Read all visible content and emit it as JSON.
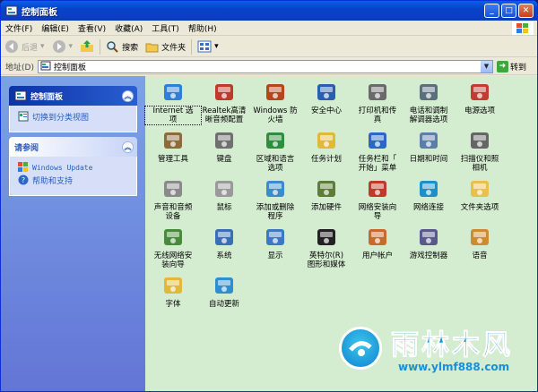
{
  "window": {
    "title": "控制面板",
    "buttons": {
      "minimize": "_",
      "maximize": "□",
      "close": "✕"
    }
  },
  "menu": [
    "文件(F)",
    "编辑(E)",
    "查看(V)",
    "收藏(A)",
    "工具(T)",
    "帮助(H)"
  ],
  "toolbar": {
    "back": "后退",
    "forward": "",
    "up": "",
    "search": "搜索",
    "folders": "文件夹",
    "views": ""
  },
  "address": {
    "label": "地址(D)",
    "value": "控制面板",
    "go": "转到"
  },
  "sidebar": {
    "panel1": {
      "title": "控制面板",
      "link": "切换到分类视图"
    },
    "panel2": {
      "title": "请参阅",
      "links": [
        "Windows Update",
        "帮助和支持"
      ]
    }
  },
  "items": [
    {
      "label": "Internet 选\n项",
      "icon": "internet-options-icon",
      "color": "#2f7ed8"
    },
    {
      "label": "Realtek高清\n晰音频配置",
      "icon": "realtek-audio-icon",
      "color": "#c0392b"
    },
    {
      "label": "Windows 防\n火墙",
      "icon": "firewall-icon",
      "color": "#b5451b"
    },
    {
      "label": "安全中心",
      "icon": "security-center-icon",
      "color": "#2a5fb0"
    },
    {
      "label": "打印机和传\n真",
      "icon": "printer-icon",
      "color": "#6a6a6a"
    },
    {
      "label": "电话和调制\n解调器选项",
      "icon": "phone-modem-icon",
      "color": "#5b6f7d"
    },
    {
      "label": "电源选项",
      "icon": "power-options-icon",
      "color": "#c43b2f"
    },
    {
      "label": "管理工具",
      "icon": "admin-tools-icon",
      "color": "#8a6d3b"
    },
    {
      "label": "键盘",
      "icon": "keyboard-icon",
      "color": "#707070"
    },
    {
      "label": "区域和语言\n选项",
      "icon": "region-language-icon",
      "color": "#2c8f3c"
    },
    {
      "label": "任务计划",
      "icon": "scheduled-tasks-icon",
      "color": "#e0b83a"
    },
    {
      "label": "任务栏和「\n开始」菜单",
      "icon": "taskbar-icon",
      "color": "#2a67c7"
    },
    {
      "label": "日期和时间",
      "icon": "date-time-icon",
      "color": "#5b7fa6"
    },
    {
      "label": "扫描仪和照\n相机",
      "icon": "scanner-camera-icon",
      "color": "#666"
    },
    {
      "label": "声音和音频\n设备",
      "icon": "sound-icon",
      "color": "#8a8a8a"
    },
    {
      "label": "鼠标",
      "icon": "mouse-icon",
      "color": "#9a9a9a"
    },
    {
      "label": "添加或删除\n程序",
      "icon": "add-remove-programs-icon",
      "color": "#3b8ccc"
    },
    {
      "label": "添加硬件",
      "icon": "add-hardware-icon",
      "color": "#5e7d3a"
    },
    {
      "label": "网络安装向\n导",
      "icon": "network-setup-icon",
      "color": "#c0392b"
    },
    {
      "label": "网络连接",
      "icon": "network-connections-icon",
      "color": "#1f8fc9"
    },
    {
      "label": "文件夹选项",
      "icon": "folder-options-icon",
      "color": "#e8c04a"
    },
    {
      "label": "无线网络安\n装向导",
      "icon": "wireless-setup-icon",
      "color": "#4a8a3c"
    },
    {
      "label": "系统",
      "icon": "system-icon",
      "color": "#3a6fb7"
    },
    {
      "label": "显示",
      "icon": "display-icon",
      "color": "#3c78c4"
    },
    {
      "label": "英特尔(R)\n图形和媒体",
      "icon": "intel-graphics-icon",
      "color": "#222"
    },
    {
      "label": "用户帐户",
      "icon": "user-accounts-icon",
      "color": "#c86a2a"
    },
    {
      "label": "游戏控制器",
      "icon": "game-controller-icon",
      "color": "#5a5a8a"
    },
    {
      "label": "语音",
      "icon": "speech-icon",
      "color": "#d08a30"
    },
    {
      "label": "字体",
      "icon": "fonts-icon",
      "color": "#e0b83a"
    },
    {
      "label": "自动更新",
      "icon": "auto-update-icon",
      "color": "#2d8fd0"
    }
  ],
  "watermark": {
    "title": "雨林木风",
    "url": "www.ylmf888.com"
  }
}
